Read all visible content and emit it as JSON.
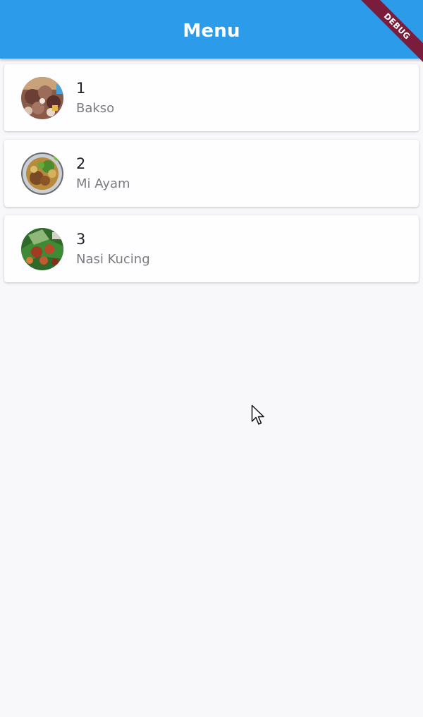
{
  "app_bar": {
    "title": "Menu",
    "color": "#2b9bea"
  },
  "debug_banner": {
    "label": "DEBUG",
    "color": "#7a1d3d"
  },
  "menu": {
    "items": [
      {
        "title": "1",
        "subtitle": "Bakso",
        "image": "bakso-photo"
      },
      {
        "title": "2",
        "subtitle": "Mi Ayam",
        "image": "mi-ayam-photo"
      },
      {
        "title": "3",
        "subtitle": "Nasi Kucing",
        "image": "nasi-kucing-photo"
      }
    ]
  },
  "icons": {
    "cursor": "mouse-pointer-icon"
  }
}
